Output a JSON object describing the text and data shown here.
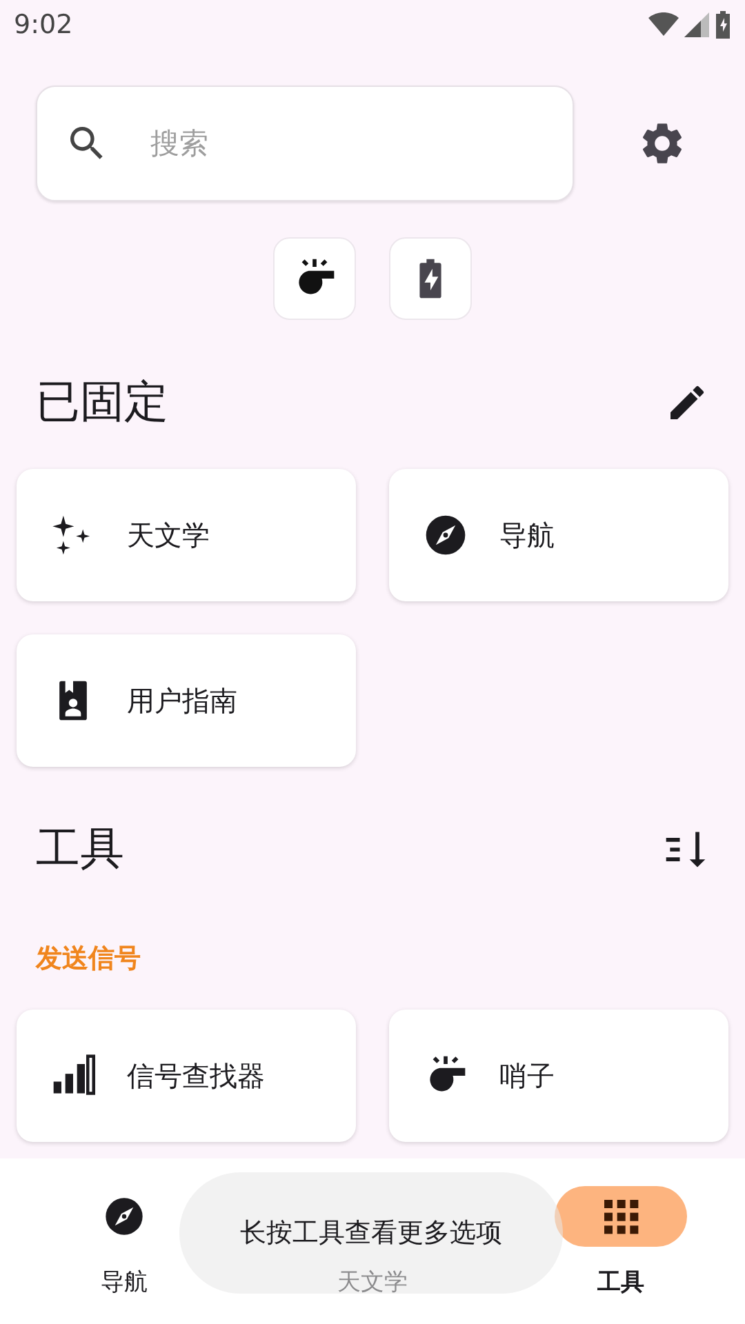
{
  "status_bar": {
    "time": "9:02"
  },
  "search": {
    "placeholder": "搜索"
  },
  "quick_actions": [
    {
      "kind": "whistle"
    },
    {
      "kind": "battery"
    }
  ],
  "pinned": {
    "title": "已固定",
    "items": [
      {
        "label": "天文学",
        "kind": "sparkles"
      },
      {
        "label": "导航",
        "kind": "compass"
      },
      {
        "label": "用户指南",
        "kind": "guide"
      }
    ]
  },
  "tools": {
    "title": "工具",
    "groups": [
      {
        "name": "发送信号",
        "items": [
          {
            "label": "信号查找器",
            "kind": "signal"
          },
          {
            "label": "哨子",
            "kind": "whistle"
          }
        ]
      }
    ]
  },
  "bottom_nav": [
    {
      "label": "导航",
      "kind": "compass",
      "selected": false
    },
    {
      "label": "天文学",
      "selected": false
    },
    {
      "label": "工具",
      "kind": "grid",
      "selected": true
    }
  ],
  "toast": {
    "text": "长按工具查看更多选项"
  }
}
